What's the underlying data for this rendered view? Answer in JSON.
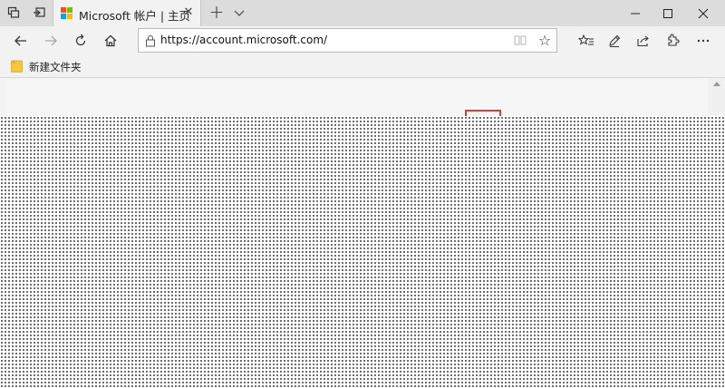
{
  "tab": {
    "title": "Microsoft 帐户 | 主页",
    "favicon_colors": [
      "#f25022",
      "#7fba00",
      "#00a4ef",
      "#ffb900"
    ]
  },
  "icons": {
    "tab_set_aside": "tabs-set-aside-icon",
    "show_tabs": "show-set-aside-tabs-icon",
    "close_tab": "close-icon",
    "new_tab": "plus-icon",
    "tab_preview": "chevron-down-icon",
    "minimize": "minimize-icon",
    "maximize": "maximize-icon",
    "close_window": "close-window-icon",
    "back": "back-arrow-icon",
    "forward": "forward-arrow-icon",
    "refresh": "refresh-icon",
    "home": "home-icon",
    "lock": "lock-icon",
    "reading_view": "reading-view-icon",
    "favorite": "star-icon",
    "favorites_hub": "favorites-hub-icon",
    "notes": "pen-icon",
    "share": "share-icon",
    "extensions": "puzzle-icon",
    "more": "more-icon",
    "folder": "folder-icon"
  },
  "address_bar": {
    "url": "https://account.microsoft.com/"
  },
  "favorites_bar": {
    "items": [
      {
        "label": "新建文件夹"
      }
    ]
  },
  "colors": {
    "chrome": "#f2f2f2",
    "tab_strip": "#dcdcdc",
    "highlight_box": "#d0433a"
  }
}
